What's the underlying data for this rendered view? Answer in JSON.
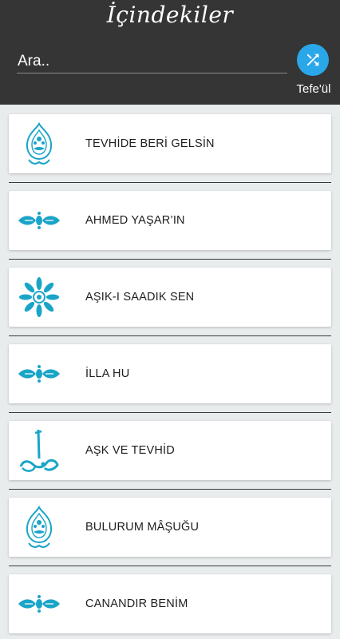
{
  "header": {
    "title": "İçindekiler",
    "search": {
      "placeholder": "Ara..",
      "value": ""
    },
    "shuffle": {
      "label": "Tefe'ül",
      "icon": "shuffle-icon"
    }
  },
  "colors": {
    "header_bg": "#353535",
    "accent": "#2aa7e8",
    "ornament": "#1aa5c8",
    "page_bg": "#e9eced"
  },
  "items": [
    {
      "title": "TEVHİDE BERİ GELSİN",
      "icon": "calligraphy-teardrop-icon"
    },
    {
      "title": "AHMED YAŞAR’IN",
      "icon": "floral-ornament-icon"
    },
    {
      "title": "AŞIK-I SAADIK SEN",
      "icon": "rosette-ornament-icon"
    },
    {
      "title": "İLLA HU",
      "icon": "floral-ornament-icon"
    },
    {
      "title": "AŞK VE TEVHİD",
      "icon": "calligraphy-hu-icon"
    },
    {
      "title": "BULURUM MÂŞUĞU",
      "icon": "calligraphy-teardrop-icon"
    },
    {
      "title": "CANANDIR BENİM",
      "icon": "floral-ornament-icon"
    }
  ]
}
